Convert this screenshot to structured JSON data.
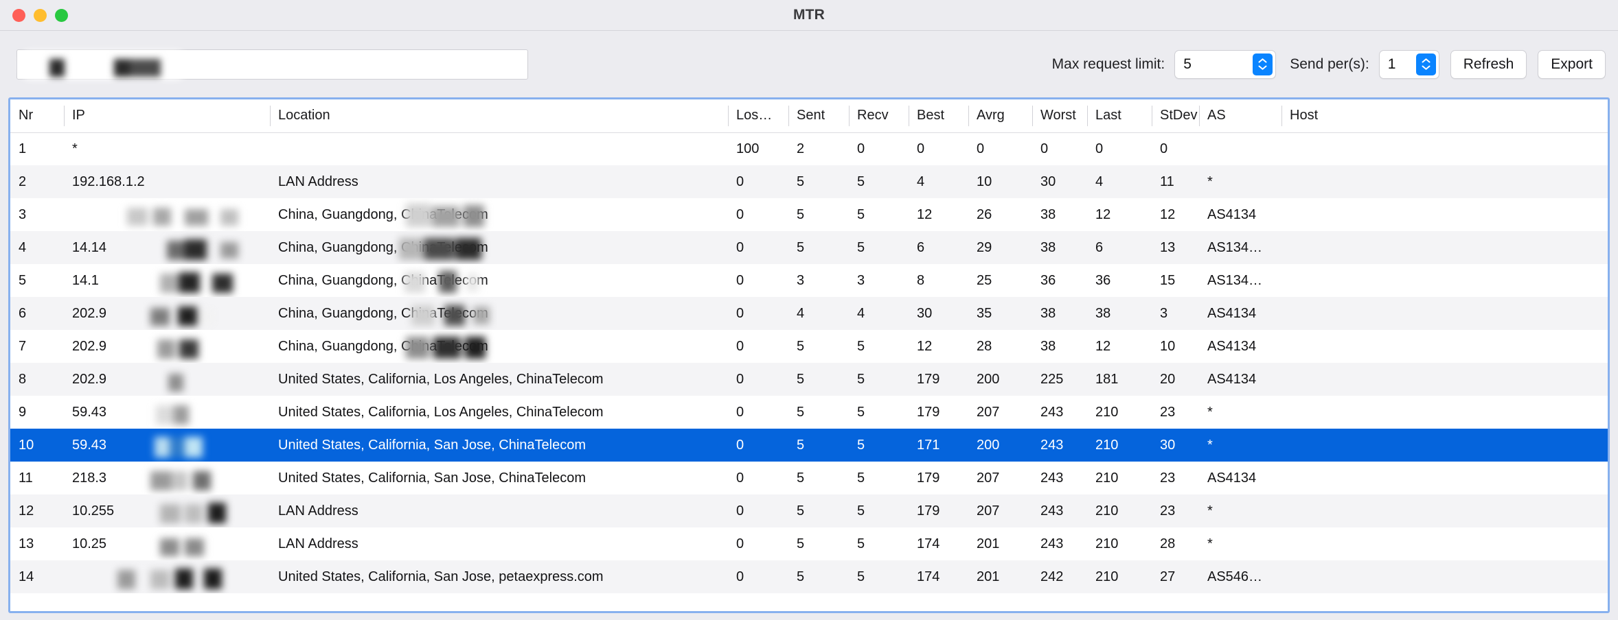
{
  "window": {
    "title": "MTR",
    "traffic_lights": [
      {
        "name": "close",
        "color": "#FF5F57"
      },
      {
        "name": "minimize",
        "color": "#FFBD2E"
      },
      {
        "name": "maximize",
        "color": "#28C840"
      }
    ]
  },
  "toolbar": {
    "search": {
      "value": "",
      "placeholder": ""
    },
    "max_request_limit": {
      "label": "Max request limit:",
      "value": "5"
    },
    "send_per_s": {
      "label": "Send per(s):",
      "value": "1"
    },
    "refresh_label": "Refresh",
    "export_label": "Export"
  },
  "table": {
    "columns": [
      "Nr",
      "IP",
      "Location",
      "Los…",
      "Sent",
      "Recv",
      "Best",
      "Avrg",
      "Worst",
      "Last",
      "StDev",
      "AS",
      "Host"
    ],
    "selected_row_index": 9,
    "accent_selected": "#0564DC",
    "focus_border": "#87B0EE",
    "rows": [
      {
        "nr": "1",
        "ip": "*",
        "location": "",
        "loss": "100",
        "sent": "2",
        "recv": "0",
        "best": "0",
        "avrg": "0",
        "worst": "0",
        "last": "0",
        "stdev": "0",
        "as": "",
        "host": ""
      },
      {
        "nr": "2",
        "ip": "192.168.1.2",
        "location": "LAN Address",
        "loss": "0",
        "sent": "5",
        "recv": "5",
        "best": "4",
        "avrg": "10",
        "worst": "30",
        "last": "4",
        "stdev": "11",
        "as": "*",
        "host": ""
      },
      {
        "nr": "3",
        "ip": "",
        "location": "China, Guangdong, ChinaTelecom",
        "loss": "0",
        "sent": "5",
        "recv": "5",
        "best": "12",
        "avrg": "26",
        "worst": "38",
        "last": "12",
        "stdev": "12",
        "as": "AS4134",
        "host": ""
      },
      {
        "nr": "4",
        "ip": "14.14",
        "location": "China, Guangdong, ChinaTelecom",
        "loss": "0",
        "sent": "5",
        "recv": "5",
        "best": "6",
        "avrg": "29",
        "worst": "38",
        "last": "6",
        "stdev": "13",
        "as": "AS134…",
        "host": ""
      },
      {
        "nr": "5",
        "ip": "14.1",
        "location": "China, Guangdong, ChinaTelecom",
        "loss": "0",
        "sent": "3",
        "recv": "3",
        "best": "8",
        "avrg": "25",
        "worst": "36",
        "last": "36",
        "stdev": "15",
        "as": "AS134…",
        "host": ""
      },
      {
        "nr": "6",
        "ip": "202.9",
        "location": "China, Guangdong, ChinaTelecom",
        "loss": "0",
        "sent": "4",
        "recv": "4",
        "best": "30",
        "avrg": "35",
        "worst": "38",
        "last": "38",
        "stdev": "3",
        "as": "AS4134",
        "host": ""
      },
      {
        "nr": "7",
        "ip": "202.9",
        "location": "China, Guangdong, ChinaTelecom",
        "loss": "0",
        "sent": "5",
        "recv": "5",
        "best": "12",
        "avrg": "28",
        "worst": "38",
        "last": "12",
        "stdev": "10",
        "as": "AS4134",
        "host": ""
      },
      {
        "nr": "8",
        "ip": "202.9",
        "location": "United States, California, Los Angeles, ChinaTelecom",
        "loss": "0",
        "sent": "5",
        "recv": "5",
        "best": "179",
        "avrg": "200",
        "worst": "225",
        "last": "181",
        "stdev": "20",
        "as": "AS4134",
        "host": ""
      },
      {
        "nr": "9",
        "ip": "59.43",
        "location": "United States, California, Los Angeles, ChinaTelecom",
        "loss": "0",
        "sent": "5",
        "recv": "5",
        "best": "179",
        "avrg": "207",
        "worst": "243",
        "last": "210",
        "stdev": "23",
        "as": "*",
        "host": ""
      },
      {
        "nr": "10",
        "ip": "59.43",
        "location": "United States, California, San Jose, ChinaTelecom",
        "loss": "0",
        "sent": "5",
        "recv": "5",
        "best": "171",
        "avrg": "200",
        "worst": "243",
        "last": "210",
        "stdev": "30",
        "as": "*",
        "host": ""
      },
      {
        "nr": "11",
        "ip": "218.3",
        "location": "United States, California, San Jose, ChinaTelecom",
        "loss": "0",
        "sent": "5",
        "recv": "5",
        "best": "179",
        "avrg": "207",
        "worst": "243",
        "last": "210",
        "stdev": "23",
        "as": "AS4134",
        "host": ""
      },
      {
        "nr": "12",
        "ip": "10.255",
        "location": "LAN Address",
        "loss": "0",
        "sent": "5",
        "recv": "5",
        "best": "179",
        "avrg": "207",
        "worst": "243",
        "last": "210",
        "stdev": "23",
        "as": "*",
        "host": ""
      },
      {
        "nr": "13",
        "ip": "10.25",
        "location": "LAN Address",
        "loss": "0",
        "sent": "5",
        "recv": "5",
        "best": "174",
        "avrg": "201",
        "worst": "243",
        "last": "210",
        "stdev": "28",
        "as": "*",
        "host": ""
      },
      {
        "nr": "14",
        "ip": "",
        "location": "United States, California, San Jose, petaexpress.com",
        "loss": "0",
        "sent": "5",
        "recv": "5",
        "best": "174",
        "avrg": "201",
        "worst": "242",
        "last": "210",
        "stdev": "27",
        "as": "AS546…",
        "host": ""
      }
    ]
  }
}
